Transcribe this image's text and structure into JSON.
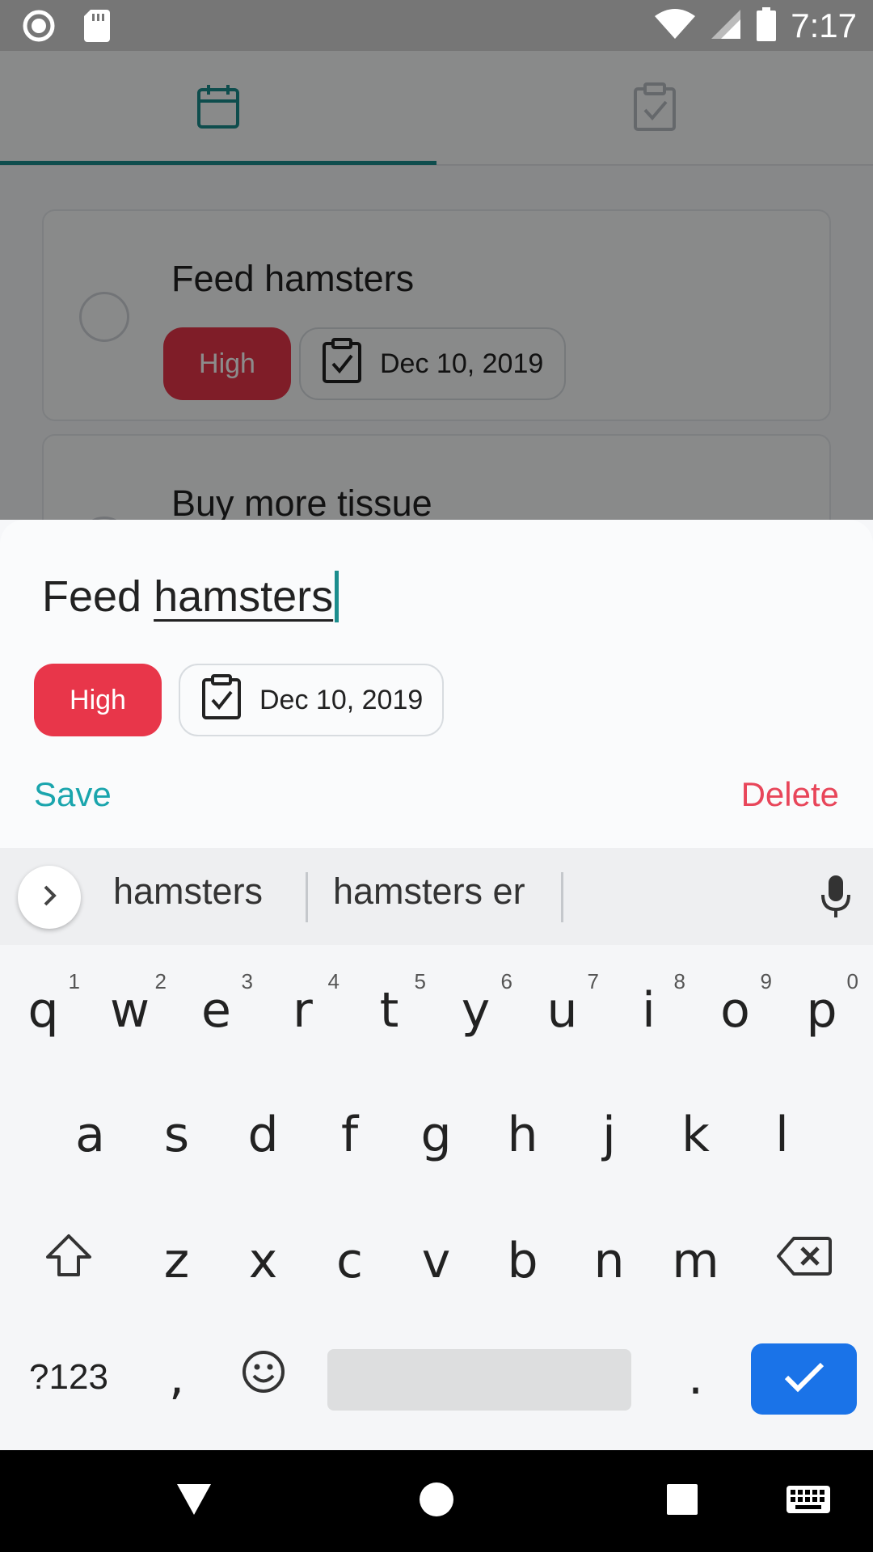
{
  "status_bar": {
    "time": "7:17",
    "icons": [
      "record-icon",
      "sd-card-icon",
      "wifi-icon",
      "signal-icon",
      "battery-icon"
    ]
  },
  "tabs": [
    {
      "icon": "calendar-icon",
      "active": true
    },
    {
      "icon": "clipboard-check-icon",
      "active": false
    }
  ],
  "tasks": [
    {
      "title": "Feed hamsters",
      "priority": "High",
      "date": "Dec 10, 2019"
    },
    {
      "title": "Buy more tissue"
    }
  ],
  "sheet": {
    "input_word1": "Feed ",
    "input_word2": "hamsters",
    "priority": "High",
    "date": "Dec 10, 2019",
    "save": "Save",
    "delete": "Delete"
  },
  "keyboard": {
    "suggestions": [
      "hamsters",
      "hamsters er"
    ],
    "row1": [
      {
        "key": "q",
        "hint": "1"
      },
      {
        "key": "w",
        "hint": "2"
      },
      {
        "key": "e",
        "hint": "3"
      },
      {
        "key": "r",
        "hint": "4"
      },
      {
        "key": "t",
        "hint": "5"
      },
      {
        "key": "y",
        "hint": "6"
      },
      {
        "key": "u",
        "hint": "7"
      },
      {
        "key": "i",
        "hint": "8"
      },
      {
        "key": "o",
        "hint": "9"
      },
      {
        "key": "p",
        "hint": "0"
      }
    ],
    "row2": [
      "a",
      "s",
      "d",
      "f",
      "g",
      "h",
      "j",
      "k",
      "l"
    ],
    "row3": [
      "z",
      "x",
      "c",
      "v",
      "b",
      "n",
      "m"
    ],
    "symbols": "?123",
    "comma": ",",
    "period": "."
  },
  "colors": {
    "accent_teal": "#1b8d8d",
    "priority_red": "#e8364a",
    "delete_red": "#e8465a",
    "save_teal": "#1aa5ad",
    "enter_blue": "#1a73e8"
  }
}
